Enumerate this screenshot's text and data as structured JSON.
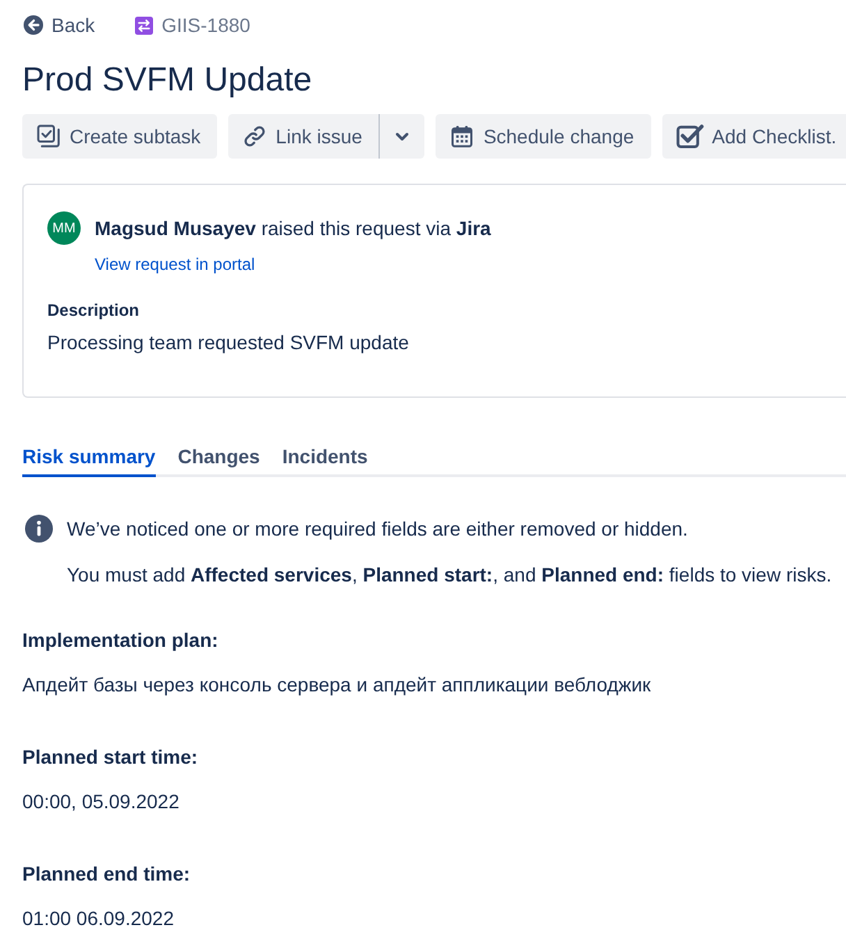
{
  "breadcrumbs": {
    "back": "Back",
    "issue_key": "GIIS-1880"
  },
  "title": "Prod SVFM Update",
  "toolbar": [
    {
      "label": "Create subtask",
      "menu": false
    },
    {
      "label": "Link issue",
      "menu": true
    },
    {
      "label": "Schedule change",
      "menu": false
    },
    {
      "label": "Add Checklist.",
      "menu": false
    }
  ],
  "request": {
    "avatar": "MM",
    "summary": "**Magsud Musayev** raised this request via **Jira**",
    "portal_link": "View request in portal",
    "description_label": "Description",
    "description": "Processing team requested SVFM update"
  },
  "tabs": [
    {
      "label": "Risk summary",
      "selected": true
    },
    {
      "label": "Changes",
      "selected": false
    },
    {
      "label": "Incidents",
      "selected": false
    }
  ],
  "notice": {
    "message": "We’ve noticed one or more required fields are either removed or hidden.",
    "detail": "You must add **Affected services**, **Planned start:**, and **Planned end:** fields to view risks."
  },
  "fields": [
    {
      "label": "Implementation plan:",
      "value": "Апдейт базы через консоль сервера и апдейт аппликации веблоджик"
    },
    {
      "label": "Planned start time:",
      "value": "00:00, 05.09.2022"
    },
    {
      "label": "Planned end time:",
      "value": "01:00 06.09.2022"
    }
  ]
}
